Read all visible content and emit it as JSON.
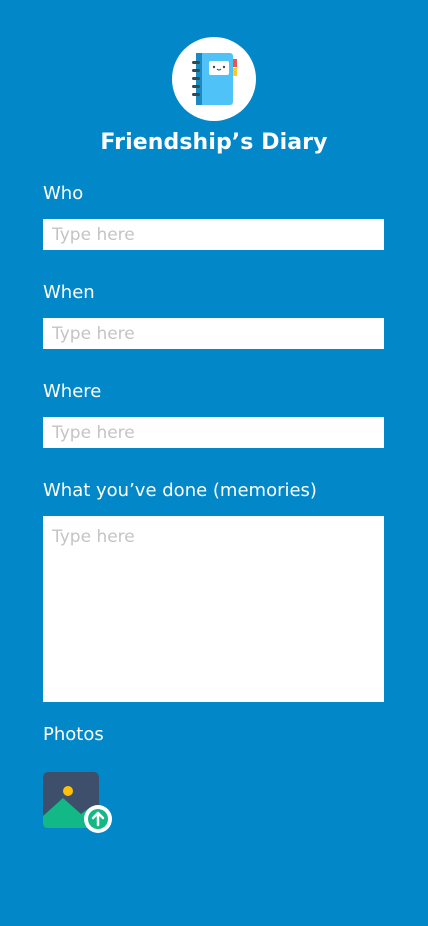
{
  "app": {
    "title": "Friendship’s Diary",
    "logo_icon": "notebook-icon"
  },
  "form": {
    "who": {
      "label": "Who",
      "placeholder": "Type here"
    },
    "when": {
      "label": "When",
      "placeholder": "Type here"
    },
    "where": {
      "label": "Where",
      "placeholder": "Type here"
    },
    "memories": {
      "label": "What you’ve done (memories)",
      "placeholder": "Type here"
    },
    "photos": {
      "label": "Photos",
      "upload_icon": "image-upload-icon"
    }
  },
  "colors": {
    "background": "#0288c9",
    "field_background": "#ffffff",
    "placeholder": "#c4c4c4",
    "upload_badge": "#12b886"
  }
}
